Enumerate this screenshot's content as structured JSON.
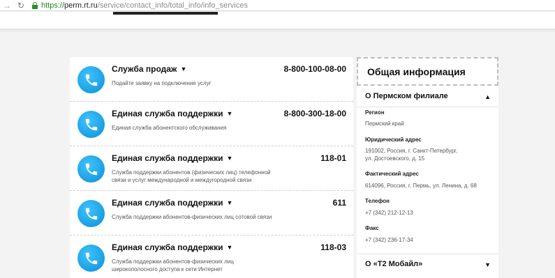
{
  "browser": {
    "url_scheme": "https://",
    "url_host": "perm.rt.ru",
    "url_path": "/service/contact_info/total_info/info_services"
  },
  "services": [
    {
      "title": "Служба продаж",
      "phone": "8-800-100-08-00",
      "desc": "Подайте заявку на подключение услуг"
    },
    {
      "title": "Единая служба поддержки",
      "phone": "8-800-300-18-00",
      "desc": "Единая служба абонентского обслуживания"
    },
    {
      "title": "Единая служба поддержки",
      "phone": "118-01",
      "desc": "Служба поддержки абонентов (физических лиц) телефонной связи и услуг международной и междугородной связи"
    },
    {
      "title": "Единая служба поддержки",
      "phone": "611",
      "desc": "Служба поддержки абонентов-физических лиц сотовой связи"
    },
    {
      "title": "Единая служба поддержки",
      "phone": "118-03",
      "desc": "Служба поддержки абонентов-физических лиц широкополосного доступа к сети Интернет"
    }
  ],
  "info": {
    "title": "Общая информация",
    "section1": {
      "title": "О Пермском филиале",
      "region_label": "Регион",
      "region_value": "Пермский край",
      "legal_label": "Юридический адрес",
      "legal_value": "191002, Россия, г. Санкт-Петербург, ул. Достоевского, д. 15",
      "actual_label": "Фактический адрес",
      "actual_value": "614096, Россия, г. Пермь, ул. Ленина, д. 68",
      "phone_label": "Телефон",
      "phone_value": "+7 (342) 212-12-13",
      "fax_label": "Факс",
      "fax_value": "+7 (342) 236-17-34"
    },
    "section2": {
      "title": "О «Т2 Мобайл»"
    }
  },
  "icons": {
    "service_icon": "phone-icon",
    "expand": "triangle-down-icon",
    "collapse": "triangle-up-icon"
  },
  "colors": {
    "accent": "#0a8fd6",
    "url_green": "#1e8a1e"
  }
}
